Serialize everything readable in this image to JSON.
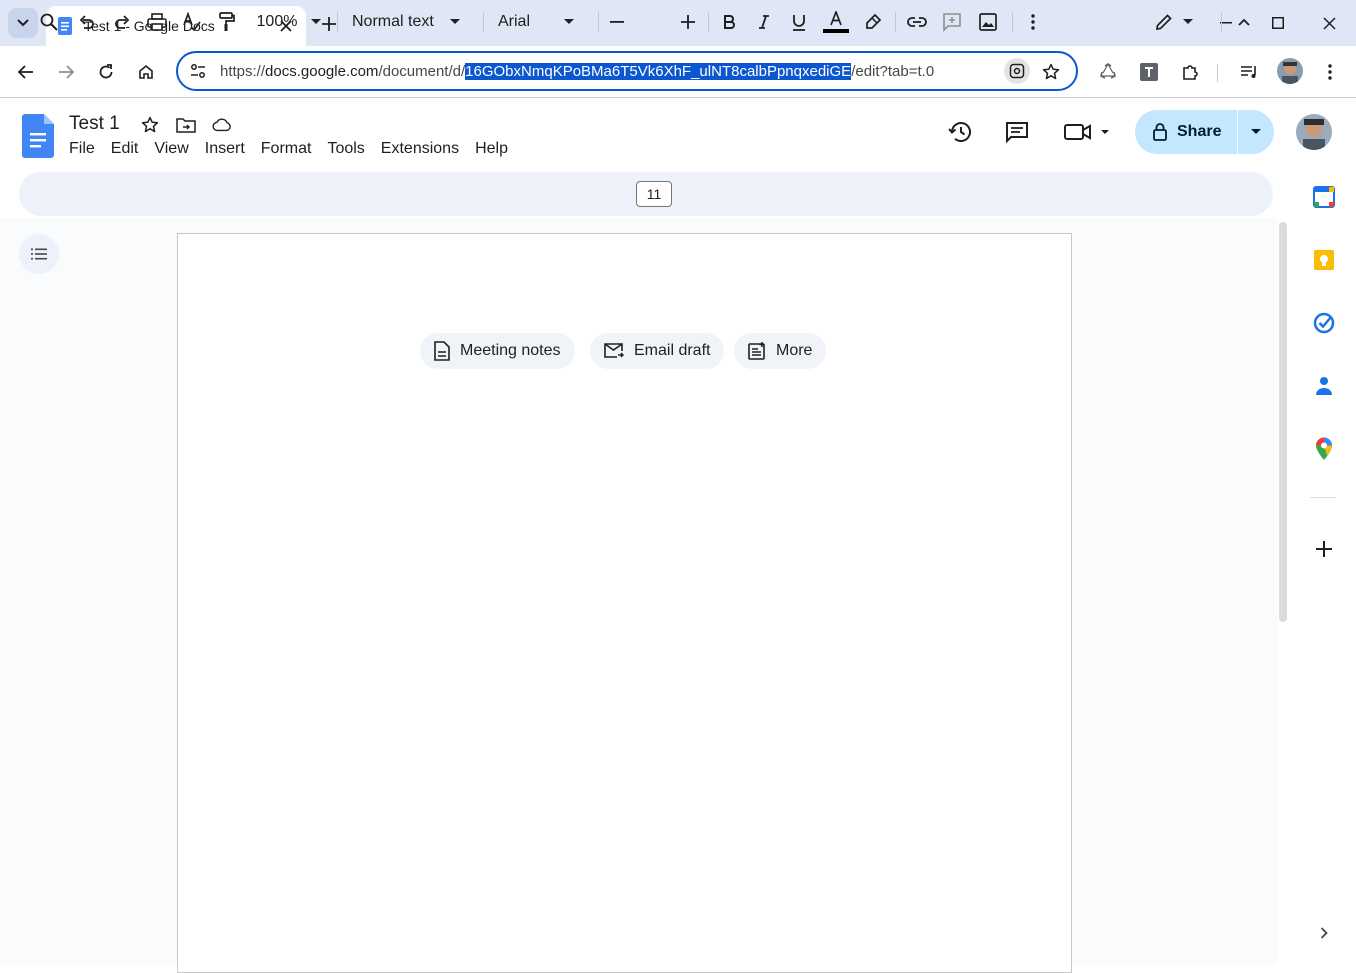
{
  "browser": {
    "tab_title": "Test 1 - Google Docs",
    "url_prefix": "https://",
    "url_host": "docs.google.com",
    "url_path": "/document/d/",
    "url_selected": "16GObxNmqKPoBMa6T5Vk6XhF_ulNT8calbPpnqxediGE",
    "url_suffix": "/edit?tab=t.0"
  },
  "doc": {
    "title": "Test 1",
    "menu": [
      "File",
      "Edit",
      "View",
      "Insert",
      "Format",
      "Tools",
      "Extensions",
      "Help"
    ],
    "share_label": "Share"
  },
  "toolbar": {
    "zoom": "100%",
    "style": "Normal text",
    "font": "Arial",
    "font_size": "11"
  },
  "chips": {
    "meeting_notes": "Meeting notes",
    "email_draft": "Email draft",
    "more": "More"
  },
  "colors": {
    "accent": "#0b57d0",
    "share_bg": "#c2e7ff",
    "toolbar_bg": "#edf2fa"
  }
}
